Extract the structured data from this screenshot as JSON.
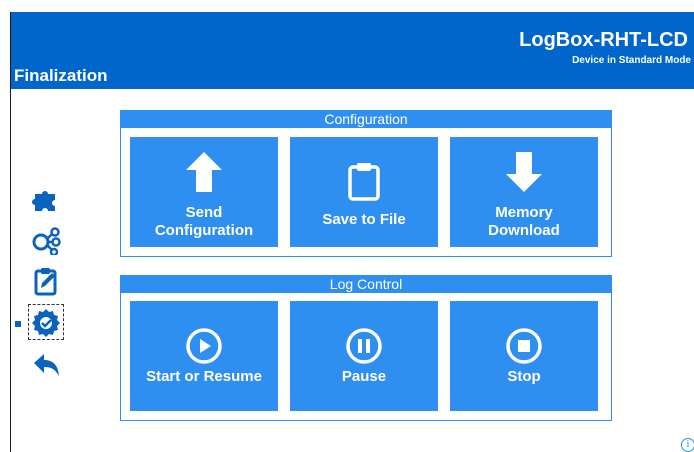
{
  "header": {
    "title": "Finalization",
    "device_name": "LogBox-RHT-LCD",
    "device_mode": "Device in Standard Mode"
  },
  "nav": [
    {
      "icon": "puzzle-icon"
    },
    {
      "icon": "share-nodes-icon"
    },
    {
      "icon": "edit-clipboard-icon"
    },
    {
      "icon": "gear-check-icon",
      "selected": true
    },
    {
      "icon": "back-arrow-icon"
    }
  ],
  "configuration": {
    "title": "Configuration",
    "send_label_1": "Send",
    "send_label_2": "Configuration",
    "save_label": "Save to File",
    "memory_label_1": "Memory",
    "memory_label_2": "Download"
  },
  "log_control": {
    "title": "Log Control",
    "start_label": "Start or Resume",
    "pause_label": "Pause",
    "stop_label": "Stop"
  },
  "colors": {
    "header_bg": "#0066cc",
    "tile_bg": "#2f8ff0",
    "nav_icon": "#0b63bd"
  },
  "info_glyph": "i"
}
